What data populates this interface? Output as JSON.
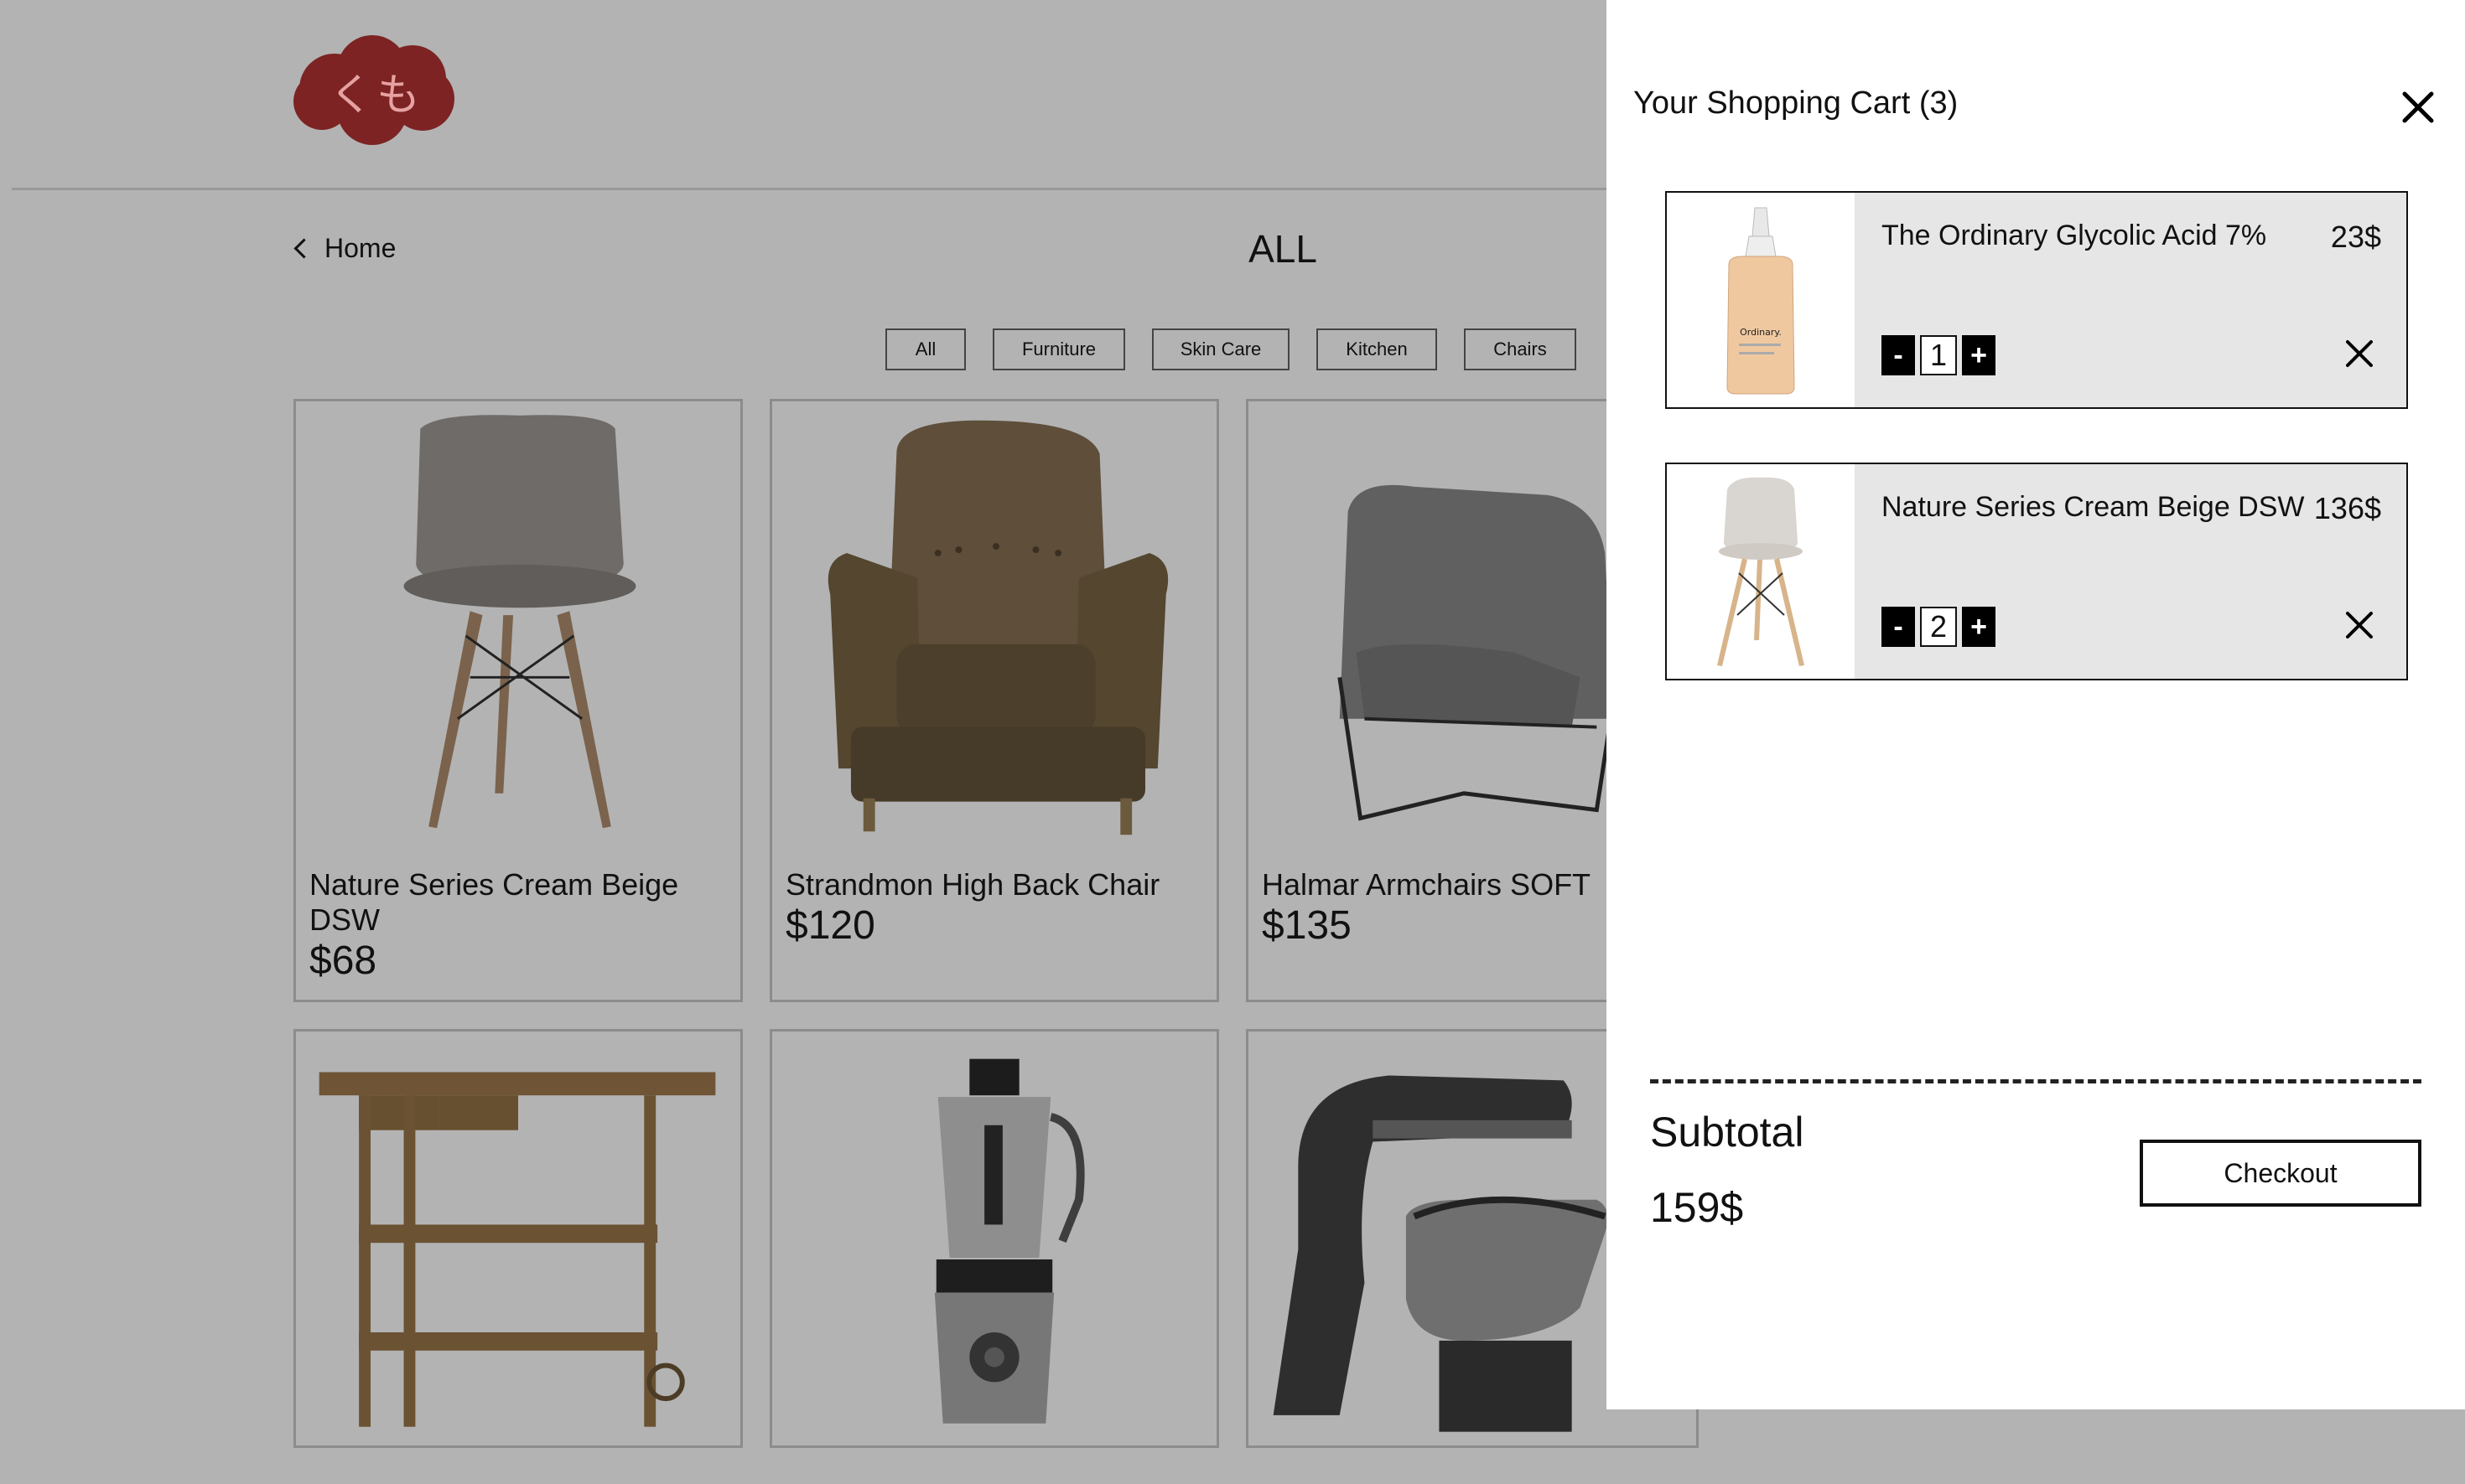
{
  "header": {
    "logo_text": "くも",
    "logo_color": "#b22a2a"
  },
  "nav": {
    "back_label": "Home",
    "page_title": "ALL"
  },
  "filters": [
    "All",
    "Furniture",
    "Skin Care",
    "Kitchen",
    "Chairs"
  ],
  "products": [
    {
      "name": "Nature Series Cream Beige DSW",
      "price": "$68"
    },
    {
      "name": "Strandmon High Back Chair",
      "price": "$120"
    },
    {
      "name": "Halmar Armchairs SOFT",
      "price": "$135"
    }
  ],
  "products_row2_icons": [
    "kitchen-cart-image",
    "blender-image",
    "stand-mixer-image"
  ],
  "cart": {
    "title": "Your Shopping Cart (3)",
    "items": [
      {
        "name": "The Ordinary Glycolic Acid 7%",
        "price": "23$",
        "qty": "1",
        "minus": "-",
        "plus": "+",
        "bottle_label": "Ordinary."
      },
      {
        "name": "Nature Series Cream Beige DSW",
        "price": "136$",
        "qty": "2",
        "minus": "-",
        "plus": "+"
      }
    ],
    "subtotal_label": "Subtotal",
    "subtotal_value": "159$",
    "checkout_label": "Checkout"
  }
}
